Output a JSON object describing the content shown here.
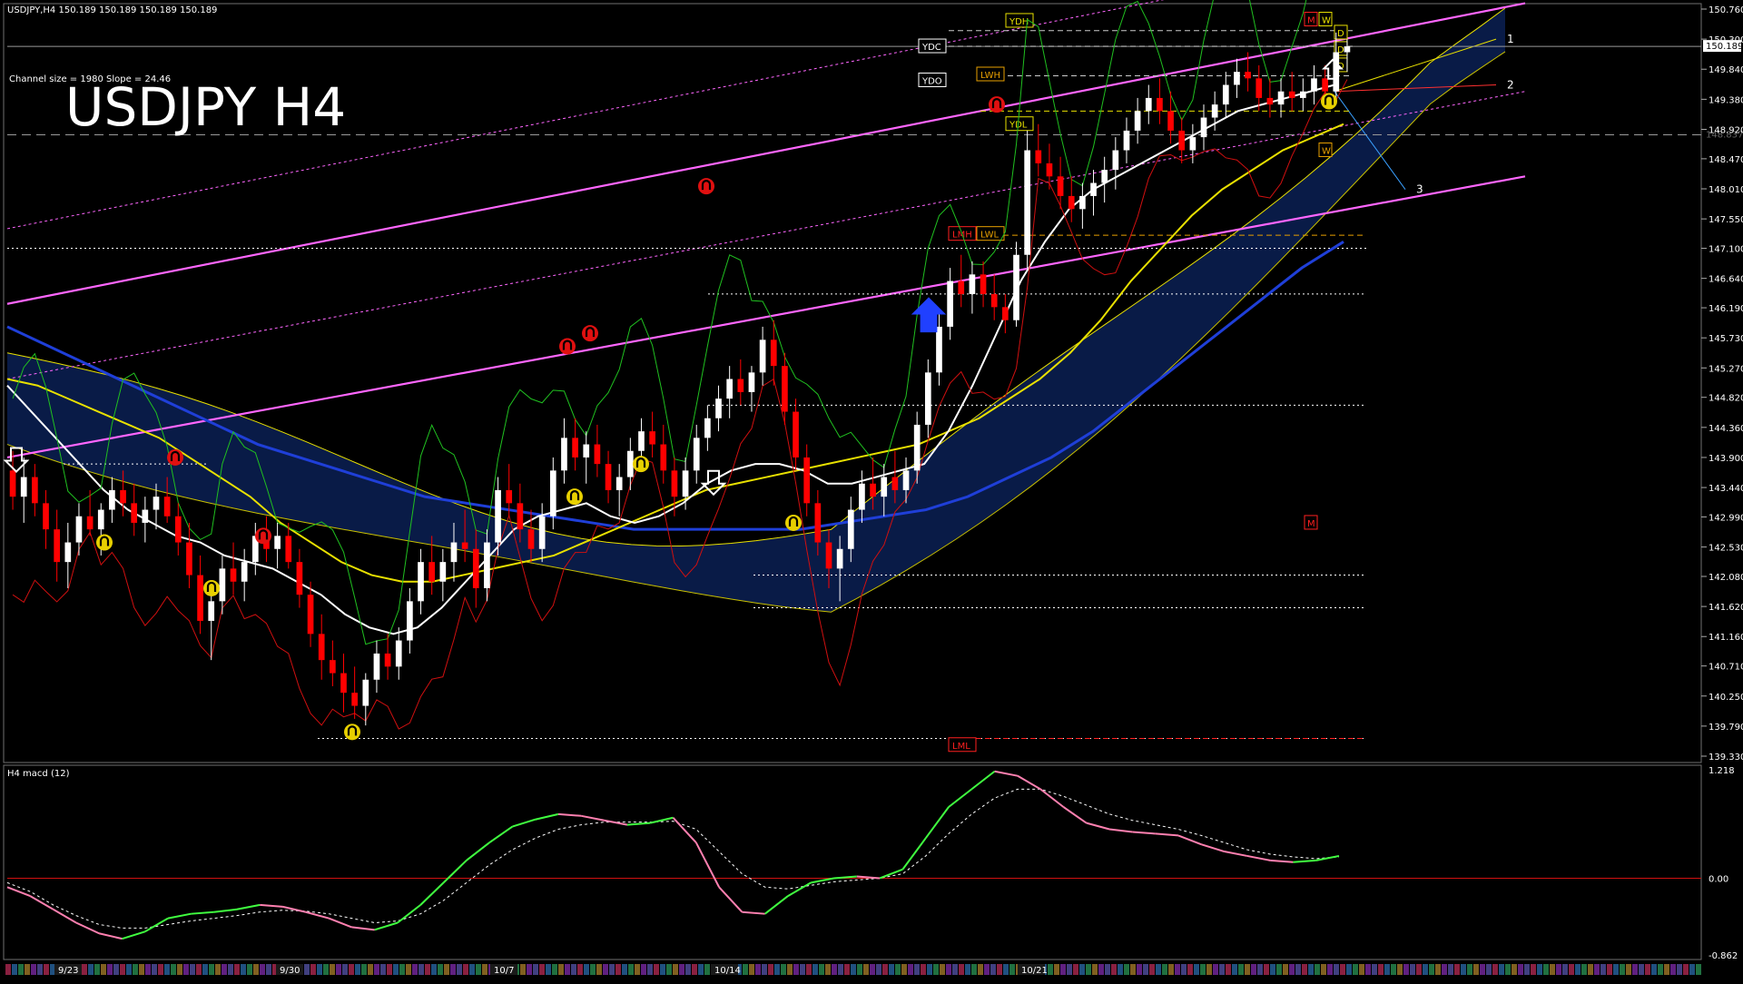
{
  "header": {
    "info_line": "USDJPY,H4  150.189 150.189 150.189 150.189",
    "channel_info": "Channel size = 1980 Slope = 24.46",
    "title": "USDJPY H4"
  },
  "colors": {
    "background": "#000000",
    "grid": "#3a3a3a",
    "bull": "#ffffff",
    "bear": "#ff0000",
    "channel": "#ff66ff",
    "sma_blue": "#1f3fd8",
    "sma_yellow": "#e8e000",
    "sma_white": "#ffffff",
    "cloud": "#2060ff",
    "cloud_bear": "#ff2020",
    "macd_up": "#40ff40",
    "macd_down": "#ff80b0"
  },
  "chart_data": {
    "type": "candlestick",
    "symbol": "USDJPY",
    "timeframe": "H4",
    "ylim": [
      139.33,
      150.76
    ],
    "price_ticks": [
      "150.760",
      "150.300",
      "149.840",
      "149.380",
      "148.920",
      "148.470",
      "148.010",
      "147.550",
      "147.100",
      "146.640",
      "146.190",
      "145.730",
      "145.270",
      "144.820",
      "144.360",
      "143.900",
      "143.440",
      "142.990",
      "142.530",
      "142.080",
      "141.620",
      "141.160",
      "140.710",
      "140.250",
      "139.790",
      "139.330"
    ],
    "current_price_label": "150.189",
    "dashed_level_label": "148.837",
    "date_labels": [
      "9/23",
      "9/30",
      "10/7",
      "10/14",
      "10/21"
    ],
    "channel_labels": [
      "1",
      "2",
      "3"
    ],
    "level_tags": [
      "YDH",
      "YDC",
      "YDO",
      "LWH",
      "YDL",
      "LMH",
      "LWL",
      "LML"
    ],
    "marker_tags": [
      "M",
      "W",
      "D",
      "D",
      "D",
      "M",
      "W"
    ],
    "candles": [
      [
        143.7,
        144.0,
        143.1,
        143.3
      ],
      [
        143.3,
        143.9,
        142.9,
        143.6
      ],
      [
        143.6,
        143.8,
        143.0,
        143.2
      ],
      [
        143.2,
        143.4,
        142.5,
        142.8
      ],
      [
        142.8,
        143.1,
        142.0,
        142.3
      ],
      [
        142.3,
        142.9,
        141.9,
        142.6
      ],
      [
        142.6,
        143.2,
        142.4,
        143.0
      ],
      [
        143.0,
        143.4,
        142.7,
        142.8
      ],
      [
        142.8,
        143.2,
        142.4,
        143.1
      ],
      [
        143.1,
        143.6,
        142.9,
        143.4
      ],
      [
        143.4,
        143.7,
        143.0,
        143.2
      ],
      [
        143.2,
        143.5,
        142.7,
        142.9
      ],
      [
        142.9,
        143.3,
        142.6,
        143.1
      ],
      [
        143.1,
        143.5,
        142.8,
        143.3
      ],
      [
        143.3,
        143.6,
        142.9,
        143.0
      ],
      [
        143.0,
        143.2,
        142.4,
        142.6
      ],
      [
        142.6,
        142.9,
        141.9,
        142.1
      ],
      [
        142.1,
        142.4,
        141.2,
        141.4
      ],
      [
        141.4,
        141.9,
        140.8,
        141.7
      ],
      [
        141.7,
        142.4,
        141.5,
        142.2
      ],
      [
        142.2,
        142.6,
        141.8,
        142.0
      ],
      [
        142.0,
        142.5,
        141.7,
        142.3
      ],
      [
        142.3,
        142.9,
        142.1,
        142.7
      ],
      [
        142.7,
        143.0,
        142.3,
        142.5
      ],
      [
        142.5,
        142.9,
        142.2,
        142.7
      ],
      [
        142.7,
        142.9,
        142.2,
        142.3
      ],
      [
        142.3,
        142.5,
        141.6,
        141.8
      ],
      [
        141.8,
        142.0,
        141.0,
        141.2
      ],
      [
        141.2,
        141.5,
        140.5,
        140.8
      ],
      [
        140.8,
        141.1,
        140.4,
        140.6
      ],
      [
        140.6,
        140.9,
        140.0,
        140.3
      ],
      [
        140.3,
        140.7,
        139.9,
        140.1
      ],
      [
        140.1,
        140.6,
        139.8,
        140.5
      ],
      [
        140.5,
        141.1,
        140.3,
        140.9
      ],
      [
        140.9,
        141.2,
        140.5,
        140.7
      ],
      [
        140.7,
        141.3,
        140.5,
        141.1
      ],
      [
        141.1,
        141.9,
        140.9,
        141.7
      ],
      [
        141.7,
        142.5,
        141.5,
        142.3
      ],
      [
        142.3,
        142.7,
        141.8,
        142.0
      ],
      [
        142.0,
        142.5,
        141.7,
        142.3
      ],
      [
        142.3,
        142.9,
        142.0,
        142.6
      ],
      [
        142.6,
        143.1,
        142.3,
        142.5
      ],
      [
        142.5,
        142.8,
        141.6,
        141.9
      ],
      [
        141.9,
        142.8,
        141.7,
        142.6
      ],
      [
        142.6,
        143.6,
        142.4,
        143.4
      ],
      [
        143.4,
        143.8,
        143.0,
        143.2
      ],
      [
        143.2,
        143.5,
        142.6,
        142.8
      ],
      [
        142.8,
        143.1,
        142.3,
        142.5
      ],
      [
        142.5,
        143.2,
        142.3,
        143.0
      ],
      [
        143.0,
        143.9,
        142.8,
        143.7
      ],
      [
        143.7,
        144.5,
        143.5,
        144.2
      ],
      [
        144.2,
        144.5,
        143.7,
        143.9
      ],
      [
        143.9,
        144.3,
        143.5,
        144.1
      ],
      [
        144.1,
        144.4,
        143.6,
        143.8
      ],
      [
        143.8,
        144.0,
        143.2,
        143.4
      ],
      [
        143.4,
        143.8,
        143.0,
        143.6
      ],
      [
        143.6,
        144.2,
        143.4,
        144.0
      ],
      [
        144.0,
        144.5,
        143.8,
        144.3
      ],
      [
        144.3,
        144.6,
        143.9,
        144.1
      ],
      [
        144.1,
        144.4,
        143.5,
        143.7
      ],
      [
        143.7,
        143.9,
        143.0,
        143.3
      ],
      [
        143.3,
        143.9,
        143.1,
        143.7
      ],
      [
        143.7,
        144.4,
        143.5,
        144.2
      ],
      [
        144.2,
        144.7,
        144.0,
        144.5
      ],
      [
        144.5,
        145.0,
        144.3,
        144.8
      ],
      [
        144.8,
        145.3,
        144.5,
        145.1
      ],
      [
        145.1,
        145.4,
        144.7,
        144.9
      ],
      [
        144.9,
        145.3,
        144.6,
        145.2
      ],
      [
        145.2,
        145.9,
        145.0,
        145.7
      ],
      [
        145.7,
        146.0,
        145.0,
        145.3
      ],
      [
        145.3,
        145.5,
        144.4,
        144.6
      ],
      [
        144.6,
        144.8,
        143.7,
        143.9
      ],
      [
        143.9,
        144.1,
        143.0,
        143.2
      ],
      [
        143.2,
        143.4,
        142.4,
        142.6
      ],
      [
        142.6,
        142.8,
        141.9,
        142.2
      ],
      [
        142.2,
        142.7,
        141.7,
        142.5
      ],
      [
        142.5,
        143.3,
        142.3,
        143.1
      ],
      [
        143.1,
        143.7,
        142.9,
        143.5
      ],
      [
        143.5,
        143.9,
        143.1,
        143.3
      ],
      [
        143.3,
        143.8,
        143.0,
        143.6
      ],
      [
        143.6,
        144.0,
        143.2,
        143.4
      ],
      [
        143.4,
        143.9,
        143.2,
        143.7
      ],
      [
        143.7,
        144.6,
        143.5,
        144.4
      ],
      [
        144.4,
        145.4,
        144.2,
        145.2
      ],
      [
        145.2,
        146.1,
        145.0,
        145.9
      ],
      [
        145.9,
        146.8,
        145.7,
        146.6
      ],
      [
        146.6,
        147.0,
        146.2,
        146.4
      ],
      [
        146.4,
        146.9,
        146.1,
        146.7
      ],
      [
        146.7,
        146.9,
        146.2,
        146.4
      ],
      [
        146.4,
        146.7,
        146.0,
        146.2
      ],
      [
        146.2,
        146.4,
        145.8,
        146.0
      ],
      [
        146.0,
        147.2,
        145.9,
        147.0
      ],
      [
        147.0,
        148.9,
        146.8,
        148.6
      ],
      [
        148.6,
        149.0,
        148.2,
        148.4
      ],
      [
        148.4,
        148.7,
        148.0,
        148.2
      ],
      [
        148.2,
        148.5,
        147.7,
        147.9
      ],
      [
        147.9,
        148.2,
        147.5,
        147.7
      ],
      [
        147.7,
        148.1,
        147.4,
        147.9
      ],
      [
        147.9,
        148.3,
        147.6,
        148.1
      ],
      [
        148.1,
        148.5,
        147.8,
        148.3
      ],
      [
        148.3,
        148.8,
        148.0,
        148.6
      ],
      [
        148.6,
        149.1,
        148.4,
        148.9
      ],
      [
        148.9,
        149.4,
        148.7,
        149.2
      ],
      [
        149.2,
        149.6,
        149.0,
        149.4
      ],
      [
        149.4,
        149.7,
        149.0,
        149.2
      ],
      [
        149.2,
        149.5,
        148.7,
        148.9
      ],
      [
        148.9,
        149.1,
        148.4,
        148.6
      ],
      [
        148.6,
        149.0,
        148.4,
        148.8
      ],
      [
        148.8,
        149.3,
        148.6,
        149.1
      ],
      [
        149.1,
        149.5,
        148.9,
        149.3
      ],
      [
        149.3,
        149.8,
        149.1,
        149.6
      ],
      [
        149.6,
        150.0,
        149.4,
        149.8
      ],
      [
        149.8,
        150.1,
        149.5,
        149.7
      ],
      [
        149.7,
        149.9,
        149.2,
        149.4
      ],
      [
        149.4,
        149.7,
        149.1,
        149.3
      ],
      [
        149.3,
        149.7,
        149.1,
        149.5
      ],
      [
        149.5,
        149.8,
        149.2,
        149.4
      ],
      [
        149.4,
        149.7,
        149.2,
        149.5
      ],
      [
        149.5,
        149.9,
        149.3,
        149.7
      ],
      [
        149.7,
        149.9,
        149.4,
        149.5
      ],
      [
        149.5,
        150.4,
        149.3,
        150.1
      ],
      [
        150.1,
        150.3,
        149.8,
        150.19
      ]
    ],
    "sma_white": [
      145.0,
      144.6,
      144.2,
      143.8,
      143.4,
      143.1,
      142.9,
      142.7,
      142.6,
      142.4,
      142.3,
      142.2,
      142.0,
      141.8,
      141.5,
      141.3,
      141.2,
      141.3,
      141.6,
      142.0,
      142.4,
      142.8,
      143.0,
      143.1,
      143.2,
      143.0,
      142.9,
      143.0,
      143.2,
      143.5,
      143.7,
      143.8,
      143.8,
      143.7,
      143.5,
      143.5,
      143.6,
      143.7,
      143.8,
      144.3,
      145.0,
      145.8,
      146.6,
      147.2,
      147.7,
      148.0,
      148.2,
      148.4,
      148.6,
      148.8,
      149.0,
      149.2,
      149.3,
      149.4,
      149.5,
      149.6
    ],
    "sma_yellow": [
      145.1,
      145.0,
      144.8,
      144.6,
      144.4,
      144.2,
      143.9,
      143.6,
      143.3,
      142.9,
      142.6,
      142.3,
      142.1,
      142.0,
      142.0,
      142.1,
      142.2,
      142.3,
      142.4,
      142.6,
      142.8,
      143.0,
      143.2,
      143.4,
      143.5,
      143.6,
      143.7,
      143.8,
      143.9,
      144.0,
      144.1,
      144.3,
      144.5,
      144.8,
      145.1,
      145.5,
      146.0,
      146.6,
      147.1,
      147.6,
      148.0,
      148.3,
      148.6,
      148.8,
      149.0
    ],
    "sma_blue": [
      145.9,
      145.6,
      145.3,
      145.0,
      144.7,
      144.4,
      144.1,
      143.9,
      143.7,
      143.5,
      143.3,
      143.2,
      143.1,
      143.0,
      142.9,
      142.8,
      142.8,
      142.8,
      142.8,
      142.8,
      142.9,
      143.0,
      143.1,
      143.3,
      143.6,
      143.9,
      144.3,
      144.8,
      145.3,
      145.8,
      146.3,
      146.8,
      147.2
    ],
    "macd": {
      "name": "H4 macd (12)",
      "ylim": [
        -0.862,
        1.218
      ],
      "ticks": [
        "1.218",
        "0.00",
        "-0.862"
      ],
      "main": [
        -0.1,
        -0.2,
        -0.35,
        -0.5,
        -0.62,
        -0.68,
        -0.6,
        -0.45,
        -0.4,
        -0.38,
        -0.35,
        -0.3,
        -0.32,
        -0.38,
        -0.45,
        -0.55,
        -0.58,
        -0.5,
        -0.3,
        -0.05,
        0.2,
        0.4,
        0.58,
        0.66,
        0.72,
        0.7,
        0.65,
        0.6,
        0.62,
        0.68,
        0.4,
        -0.1,
        -0.38,
        -0.4,
        -0.2,
        -0.05,
        0.0,
        0.02,
        0.0,
        0.1,
        0.45,
        0.8,
        1.0,
        1.2,
        1.15,
        1.0,
        0.8,
        0.62,
        0.55,
        0.52,
        0.5,
        0.48,
        0.38,
        0.3,
        0.25,
        0.2,
        0.18,
        0.2,
        0.25
      ],
      "signal": [
        -0.05,
        -0.15,
        -0.3,
        -0.42,
        -0.52,
        -0.56,
        -0.56,
        -0.52,
        -0.48,
        -0.45,
        -0.42,
        -0.38,
        -0.36,
        -0.37,
        -0.4,
        -0.45,
        -0.5,
        -0.48,
        -0.4,
        -0.25,
        -0.05,
        0.15,
        0.32,
        0.45,
        0.55,
        0.6,
        0.63,
        0.63,
        0.63,
        0.64,
        0.55,
        0.3,
        0.05,
        -0.1,
        -0.12,
        -0.08,
        -0.04,
        -0.02,
        0.0,
        0.05,
        0.25,
        0.5,
        0.72,
        0.9,
        1.0,
        1.0,
        0.92,
        0.82,
        0.72,
        0.65,
        0.6,
        0.55,
        0.48,
        0.4,
        0.32,
        0.27,
        0.24,
        0.22,
        0.24
      ]
    }
  }
}
